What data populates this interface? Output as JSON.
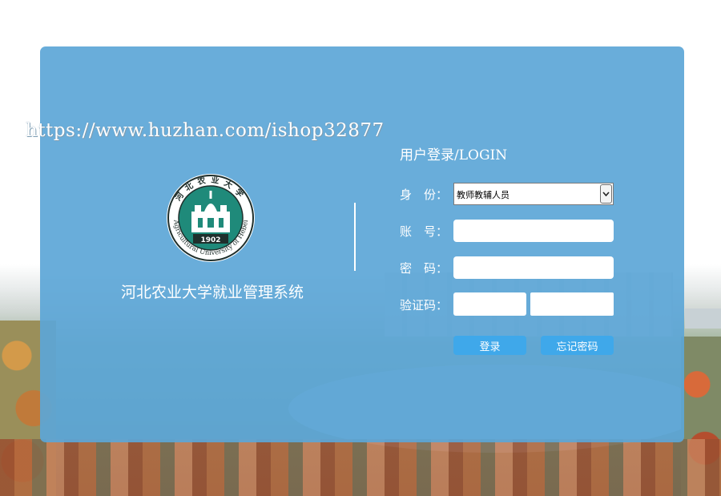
{
  "watermark": "https://www.huzhan.com/ishop32877",
  "logo": {
    "top_text": "河北农业大学",
    "ring_text": "Agricultural University of Hebei",
    "year": "1902"
  },
  "system_title": "河北农业大学就业管理系统",
  "login": {
    "heading": "用户登录/LOGIN",
    "role_label": "身　份：",
    "role_selected": "教师教辅人员",
    "account_label": "账　号：",
    "account_value": "",
    "password_label": "密　码：",
    "password_value": "",
    "captcha_label": "验证码：",
    "captcha_value": "",
    "login_button": "登录",
    "forgot_button": "忘记密码"
  },
  "colors": {
    "panel": "#5ca6d7",
    "button": "#3fa8ea",
    "logo_green": "#1f8a7a"
  }
}
